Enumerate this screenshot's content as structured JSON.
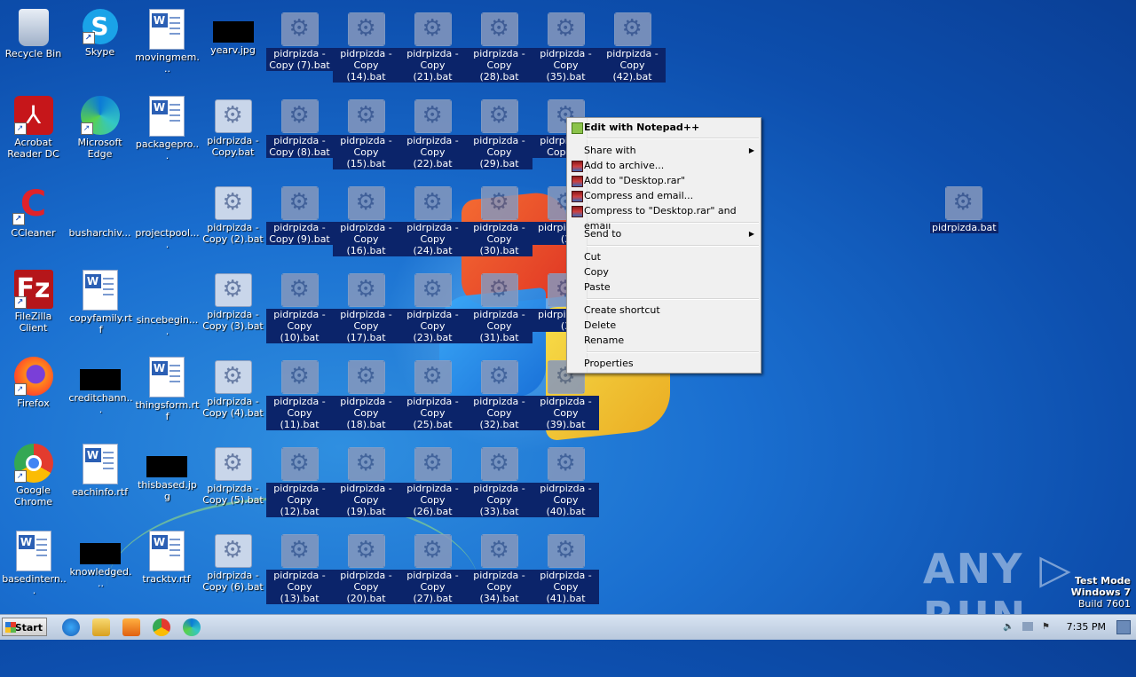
{
  "desktop": {
    "icons": [
      {
        "label": "Recycle Bin",
        "kind": "recycle"
      },
      {
        "label": "Skype",
        "kind": "skype"
      },
      {
        "label": "movingmem...",
        "kind": "word"
      },
      {
        "label": "yearv.jpg",
        "kind": "black"
      },
      {
        "label": "pidrpizda - Copy (7).bat",
        "kind": "bat"
      },
      {
        "label": "pidrpizda - Copy (14).bat",
        "kind": "bat"
      },
      {
        "label": "pidrpizda - Copy (21).bat",
        "kind": "bat"
      },
      {
        "label": "pidrpizda - Copy (28).bat",
        "kind": "bat"
      },
      {
        "label": "pidrpizda - Copy (35).bat",
        "kind": "bat"
      },
      {
        "label": "pidrpizda - Copy (42).bat",
        "kind": "bat"
      },
      {
        "label": "Acrobat Reader DC",
        "kind": "acrobat"
      },
      {
        "label": "Microsoft Edge",
        "kind": "edge"
      },
      {
        "label": "packagepro...",
        "kind": "word"
      },
      {
        "label": "pidrpizda - Copy.bat",
        "kind": "bat"
      },
      {
        "label": "pidrpizda - Copy (8).bat",
        "kind": "bat"
      },
      {
        "label": "pidrpizda - Copy (15).bat",
        "kind": "bat"
      },
      {
        "label": "pidrpizda - Copy (22).bat",
        "kind": "bat"
      },
      {
        "label": "pidrpizda - Copy (29).bat",
        "kind": "bat"
      },
      {
        "label": "pidrpizda - Copy (3",
        "kind": "bat"
      },
      {
        "label": "CCleaner",
        "kind": "ccleaner"
      },
      {
        "label": "busharchiv...",
        "kind": "blank"
      },
      {
        "label": "projectpool....",
        "kind": "blank"
      },
      {
        "label": "pidrpizda - Copy (2).bat",
        "kind": "bat"
      },
      {
        "label": "pidrpizda - Copy (9).bat",
        "kind": "bat"
      },
      {
        "label": "pidrpizda - Copy (16).bat",
        "kind": "bat"
      },
      {
        "label": "pidrpizda - Copy (24).bat",
        "kind": "bat"
      },
      {
        "label": "pidrpizda - Copy (30).bat",
        "kind": "bat"
      },
      {
        "label": "pidrpi Copy (3",
        "kind": "bat"
      },
      {
        "label": "pidrpizda.bat",
        "kind": "bat"
      },
      {
        "label": "FileZilla Client",
        "kind": "filezilla"
      },
      {
        "label": "copyfamily.rtf",
        "kind": "word"
      },
      {
        "label": "sincebegin....",
        "kind": "blank"
      },
      {
        "label": "pidrpizda - Copy (3).bat",
        "kind": "bat"
      },
      {
        "label": "pidrpizda - Copy (10).bat",
        "kind": "bat"
      },
      {
        "label": "pidrpizda - Copy (17).bat",
        "kind": "bat"
      },
      {
        "label": "pidrpizda - Copy (23).bat",
        "kind": "bat"
      },
      {
        "label": "pidrpizda - Copy (31).bat",
        "kind": "bat"
      },
      {
        "label": "pidrpi Copy (3",
        "kind": "bat"
      },
      {
        "label": "Firefox",
        "kind": "firefox"
      },
      {
        "label": "creditchann...",
        "kind": "black"
      },
      {
        "label": "thingsform.rtf",
        "kind": "word"
      },
      {
        "label": "pidrpizda - Copy (4).bat",
        "kind": "bat"
      },
      {
        "label": "pidrpizda - Copy (11).bat",
        "kind": "bat"
      },
      {
        "label": "pidrpizda - Copy (18).bat",
        "kind": "bat"
      },
      {
        "label": "pidrpizda - Copy (25).bat",
        "kind": "bat"
      },
      {
        "label": "pidrpizda - Copy (32).bat",
        "kind": "bat"
      },
      {
        "label": "pidrpizda - Copy (39).bat",
        "kind": "bat"
      },
      {
        "label": "Google Chrome",
        "kind": "chrome"
      },
      {
        "label": "eachinfo.rtf",
        "kind": "word"
      },
      {
        "label": "thisbased.jpg",
        "kind": "black"
      },
      {
        "label": "pidrpizda - Copy (5).bat",
        "kind": "bat"
      },
      {
        "label": "pidrpizda - Copy (12).bat",
        "kind": "bat"
      },
      {
        "label": "pidrpizda - Copy (19).bat",
        "kind": "bat"
      },
      {
        "label": "pidrpizda - Copy (26).bat",
        "kind": "bat"
      },
      {
        "label": "pidrpizda - Copy (33).bat",
        "kind": "bat"
      },
      {
        "label": "pidrpizda - Copy (40).bat",
        "kind": "bat"
      },
      {
        "label": "basedintern...",
        "kind": "word"
      },
      {
        "label": "knowledged...",
        "kind": "black"
      },
      {
        "label": "tracktv.rtf",
        "kind": "word"
      },
      {
        "label": "pidrpizda - Copy (6).bat",
        "kind": "bat"
      },
      {
        "label": "pidrpizda - Copy (13).bat",
        "kind": "bat"
      },
      {
        "label": "pidrpizda - Copy (20).bat",
        "kind": "bat"
      },
      {
        "label": "pidrpizda - Copy (27).bat",
        "kind": "bat"
      },
      {
        "label": "pidrpizda - Copy (34).bat",
        "kind": "bat"
      },
      {
        "label": "pidrpizda - Copy (41).bat",
        "kind": "bat"
      }
    ]
  },
  "context_menu": {
    "edit_notepad": "Edit with Notepad++",
    "share_with": "Share with",
    "add_archive": "Add to archive...",
    "add_rar": "Add to \"Desktop.rar\"",
    "compress_email": "Compress and email...",
    "compress_rar_email": "Compress to \"Desktop.rar\" and email",
    "send_to": "Send to",
    "cut": "Cut",
    "copy": "Copy",
    "paste": "Paste",
    "create_shortcut": "Create shortcut",
    "delete": "Delete",
    "rename": "Rename",
    "properties": "Properties"
  },
  "taskbar": {
    "start_label": "Start",
    "clock": "7:35 PM"
  },
  "watermark": {
    "text": "ANY ▷ RUN",
    "test_mode": "Test Mode",
    "os": "Windows 7",
    "build": "Build 7601"
  },
  "colors": {
    "selection": "#0b246a",
    "desktop_blue": "#1a6fd0"
  }
}
